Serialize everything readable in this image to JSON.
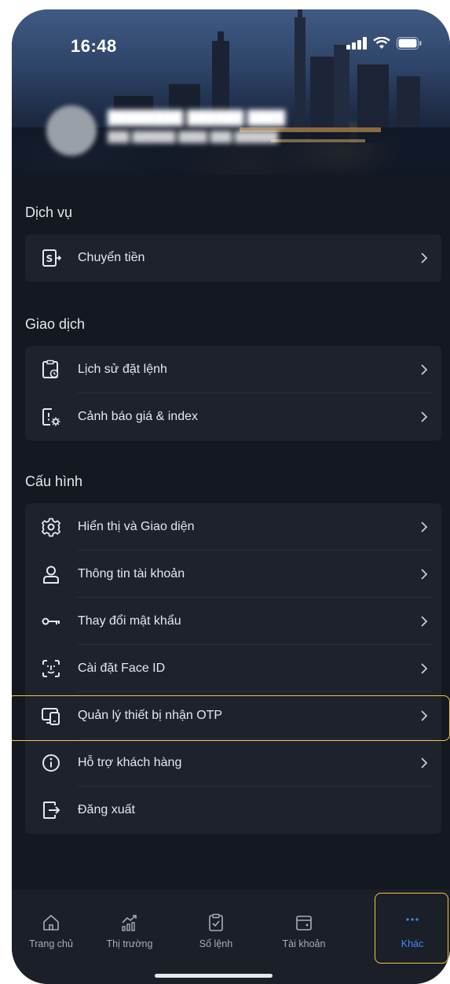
{
  "status_bar": {
    "time": "16:48"
  },
  "sections": {
    "services": {
      "title": "Dịch vụ",
      "items": [
        {
          "label": "Chuyển tiền",
          "icon": "money-transfer-icon"
        }
      ]
    },
    "trading": {
      "title": "Giao dịch",
      "items": [
        {
          "label": "Lịch sử đặt lệnh",
          "icon": "order-history-icon"
        },
        {
          "label": "Cảnh báo giá & index",
          "icon": "price-alert-icon"
        }
      ]
    },
    "settings": {
      "title": "Cấu hình",
      "items": [
        {
          "label": "Hiển thị và Giao diện",
          "icon": "gear-icon"
        },
        {
          "label": "Thông tin tài khoản",
          "icon": "user-icon"
        },
        {
          "label": "Thay đổi mật khẩu",
          "icon": "key-icon"
        },
        {
          "label": "Cài đặt Face ID",
          "icon": "face-id-icon"
        },
        {
          "label": "Quản lý thiết bị nhận OTP",
          "icon": "otp-devices-icon"
        },
        {
          "label": "Hỗ trợ khách hàng",
          "icon": "info-icon"
        },
        {
          "label": "Đăng xuất",
          "icon": "logout-icon"
        }
      ]
    }
  },
  "tabbar": {
    "items": [
      {
        "label": "Trang chủ",
        "icon": "home-icon"
      },
      {
        "label": "Thị trường",
        "icon": "market-chart-icon"
      },
      {
        "label": "Sổ lệnh",
        "icon": "order-book-icon"
      },
      {
        "label": "Tài khoản",
        "icon": "wallet-icon"
      },
      {
        "label": "Khác",
        "icon": "more-icon"
      }
    ],
    "active": "Khác"
  },
  "colors": {
    "accent": "#3d8bff",
    "highlight": "#f0c84a",
    "background": "#141820",
    "card": "#1d222c"
  }
}
